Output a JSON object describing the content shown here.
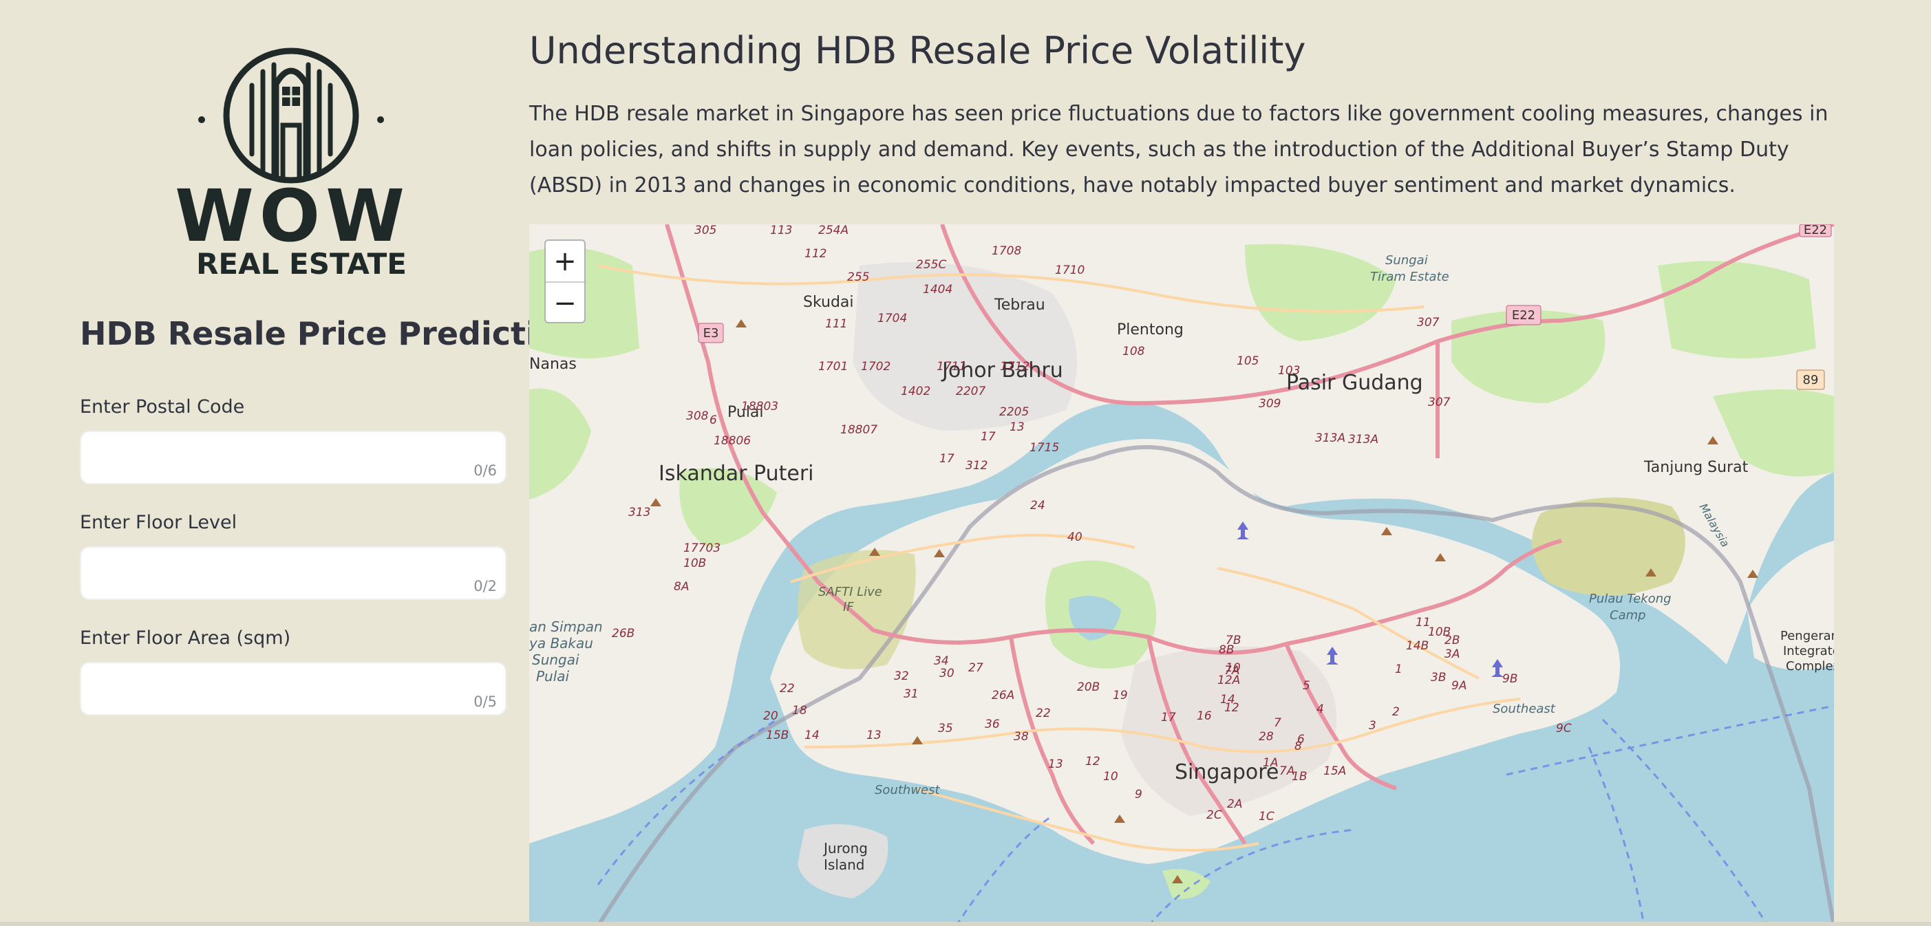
{
  "sidebar": {
    "logo": {
      "wordmark": "WOW",
      "subtitle": "REAL ESTATE"
    },
    "title": "HDB Resale Price Prediction",
    "fields": [
      {
        "label": "Enter Postal Code",
        "value": "",
        "counter": "0/6"
      },
      {
        "label": "Enter Floor Level",
        "value": "",
        "counter": "0/2"
      },
      {
        "label": "Enter Floor Area (sqm)",
        "value": "",
        "counter": "0/5"
      }
    ]
  },
  "main": {
    "title": "Understanding HDB Resale Price Volatility",
    "description": "The HDB resale market in Singapore has seen price fluctuations due to factors like government cooling measures, changes in loan policies, and shifts in supply and demand. Key events, such as the introduction of the Additional Buyer’s Stamp Duty (ABSD) in 2013 and changes in economic conditions, have notably impacted buyer sentiment and market dynamics."
  },
  "map": {
    "zoom_in": "+",
    "zoom_out": "−",
    "places": {
      "johor_bahru": "Johor Bahru",
      "pasir_gudang": "Pasir Gudang",
      "iskandar_puteri": "Iskandar Puteri",
      "singapore": "Singapore",
      "skudai": "Skudai",
      "tebrau": "Tebrau",
      "plentong": "Plentong",
      "pulai": "Pulai",
      "nanas": "Nanas",
      "sungai_tiram": "Sungai",
      "sungai_tiram_2": "Tiram Estate",
      "tanjung_surat": "Tanjung Surat",
      "pulau_tekong": "Pulau Tekong",
      "pulau_tekong_2": "Camp",
      "safti": "SAFTI Live",
      "safti_2": "IF",
      "jurong_island": "Jurong",
      "jurong_island_2": "Island",
      "southwest": "Southwest",
      "southeast": "Southeast",
      "malaysia": "Malaysia",
      "pengerang": "Pengeran",
      "pengerang_2": "Integrate",
      "pengerang_3": "Complex",
      "tanjung_simpan": "an Simpan",
      "tanjung_simpan_2": "ya Bakau",
      "tanjung_simpan_3": "Sungai",
      "tanjung_simpan_4": "Pulai"
    },
    "road_shields": [
      "E3",
      "E22",
      "89",
      "E22"
    ],
    "route_numbers": [
      "305",
      "113",
      "254A",
      "112",
      "255",
      "255C",
      "1708",
      "111",
      "1704",
      "1404",
      "1710",
      "1701",
      "1702",
      "1711",
      "1712",
      "108",
      "105",
      "103",
      "1402",
      "2207",
      "2205",
      "309",
      "307",
      "307",
      "308",
      "6",
      "18806",
      "18803",
      "18807",
      "13",
      "17",
      "1715",
      "17",
      "312",
      "313A",
      "313A",
      "313",
      "17703",
      "10B",
      "8A",
      "26B",
      "24",
      "40",
      "22",
      "20",
      "18",
      "15B",
      "14",
      "13",
      "35",
      "36",
      "38",
      "34",
      "32",
      "31",
      "30",
      "27",
      "26A",
      "22",
      "20B",
      "19",
      "17",
      "16",
      "14",
      "12",
      "12A",
      "10",
      "8B",
      "7B",
      "7A",
      "7",
      "6",
      "5",
      "4",
      "3",
      "2",
      "1",
      "2B",
      "3A",
      "3B",
      "9A",
      "9B",
      "9C",
      "10B",
      "11",
      "14B",
      "15A",
      "1B",
      "1A",
      "28",
      "2A",
      "2C",
      "1C",
      "7A",
      "8",
      "9",
      "10",
      "12",
      "13"
    ]
  }
}
